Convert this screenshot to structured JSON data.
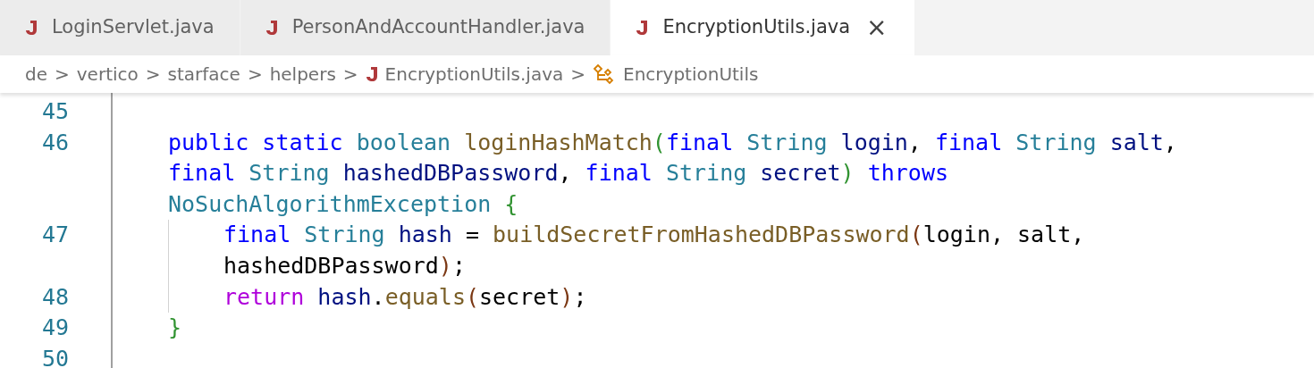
{
  "tabs": [
    {
      "label": "LoginServlet.java",
      "selected": false
    },
    {
      "label": "PersonAndAccountHandler.java",
      "selected": false
    },
    {
      "label": "EncryptionUtils.java",
      "selected": true,
      "close_glyph": "×"
    }
  ],
  "breadcrumb": [
    {
      "label": "de",
      "kind": "folder"
    },
    {
      "label": "vertico",
      "kind": "folder"
    },
    {
      "label": "starface",
      "kind": "folder"
    },
    {
      "label": "helpers",
      "kind": "folder"
    },
    {
      "label": "EncryptionUtils.java",
      "kind": "java-file"
    },
    {
      "label": "EncryptionUtils",
      "kind": "class"
    }
  ],
  "separator": ">",
  "lines": [
    {
      "number": "45"
    },
    {
      "children": [
        {
          "number": "46",
          "rows": [
            {
              "tokens": [
                {
                  "text": "public ",
                  "kind": "keyword"
                },
                {
                  "text": "static ",
                  "kind": "keyword"
                },
                {
                  "text": "boolean ",
                  "kind": "type"
                },
                {
                  "text": "loginHashMatch",
                  "kind": "function"
                },
                {
                  "text": "(",
                  "kind": "bracket1"
                },
                {
                  "text": "final ",
                  "kind": "keyword"
                },
                {
                  "text": "String ",
                  "kind": "type"
                },
                {
                  "text": "login",
                  "kind": "variable"
                },
                {
                  "text": ", "
                },
                {
                  "text": "final ",
                  "kind": "keyword"
                },
                {
                  "text": "String ",
                  "kind": "type"
                },
                {
                  "text": "salt",
                  "kind": "variable"
                },
                {
                  "text": ","
                }
              ]
            },
            {
              "tokens": [
                {
                  "text": "final ",
                  "kind": "keyword"
                },
                {
                  "text": "String ",
                  "kind": "type"
                },
                {
                  "text": "hashedDBPassword",
                  "kind": "variable"
                },
                {
                  "text": ", "
                },
                {
                  "text": "final ",
                  "kind": "keyword"
                },
                {
                  "text": "String ",
                  "kind": "type"
                },
                {
                  "text": "secret",
                  "kind": "variable"
                },
                {
                  "text": ") ",
                  "kind": "bracket1"
                },
                {
                  "text": "throws",
                  "kind": "keyword"
                }
              ]
            },
            {
              "tokens": [
                {
                  "text": "NoSuchAlgorithmException ",
                  "kind": "type"
                },
                {
                  "text": "{",
                  "kind": "bracket1"
                }
              ]
            }
          ]
        },
        {
          "children": [
            {
              "number": "47",
              "rows": [
                {
                  "tokens": [
                    {
                      "text": "final ",
                      "kind": "keyword"
                    },
                    {
                      "text": "String ",
                      "kind": "type"
                    },
                    {
                      "text": "hash",
                      "kind": "variable"
                    },
                    {
                      "text": " = "
                    },
                    {
                      "text": "buildSecretFromHashedDBPassword",
                      "kind": "function"
                    },
                    {
                      "text": "(",
                      "kind": "bracket2"
                    },
                    {
                      "text": "login, salt,"
                    }
                  ]
                },
                {
                  "tokens": [
                    {
                      "text": "hashedDBPassword"
                    },
                    {
                      "text": ")",
                      "kind": "bracket2"
                    },
                    {
                      "text": ";"
                    }
                  ]
                }
              ]
            },
            {
              "number": "48",
              "rows": [
                {
                  "tokens": [
                    {
                      "text": "return ",
                      "kind": "control"
                    },
                    {
                      "text": "hash",
                      "kind": "variable"
                    },
                    {
                      "text": "."
                    },
                    {
                      "text": "equals",
                      "kind": "function"
                    },
                    {
                      "text": "(",
                      "kind": "bracket2"
                    },
                    {
                      "text": "secret"
                    },
                    {
                      "text": ")",
                      "kind": "bracket2"
                    },
                    {
                      "text": ";"
                    }
                  ]
                }
              ]
            }
          ]
        },
        {
          "number": "49",
          "rows": [
            {
              "tokens": [
                {
                  "text": "}",
                  "kind": "bracket1"
                }
              ]
            }
          ]
        }
      ]
    },
    {
      "number": "50"
    }
  ]
}
